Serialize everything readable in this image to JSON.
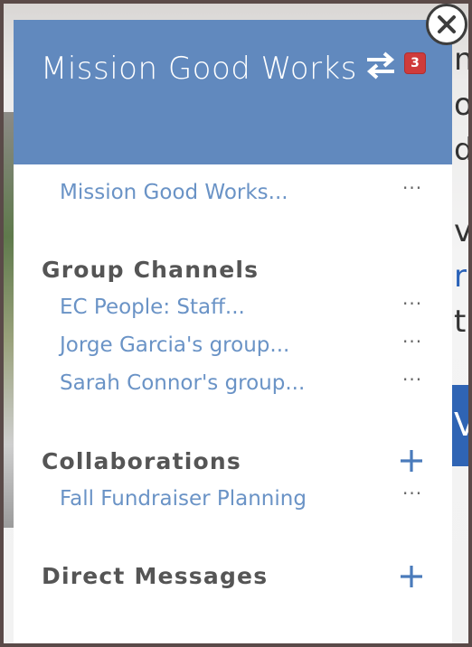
{
  "panel": {
    "title": "Mission Good Works",
    "notification_count": "3",
    "sections": {
      "pinned": {
        "items": [
          {
            "label": "Mission Good Works..."
          }
        ]
      },
      "group_channels": {
        "heading": "Group Channels",
        "items": [
          {
            "label": "EC People: Staff..."
          },
          {
            "label": "Jorge Garcia's group..."
          },
          {
            "label": "Sarah Connor's group..."
          }
        ]
      },
      "collaborations": {
        "heading": "Collaborations",
        "items": [
          {
            "label": "Fall Fundraiser Planning"
          }
        ]
      },
      "direct_messages": {
        "heading": "Direct Messages"
      }
    },
    "more_glyph": "···"
  },
  "colors": {
    "header": "#6189be",
    "link": "#6a93c6",
    "badge": "#cf3b3b",
    "plus": "#4a7bbb"
  },
  "icons": {
    "switch": "switch-arrows-icon",
    "close": "close-icon",
    "more": "more-horizontal-icon",
    "add": "plus-icon"
  }
}
